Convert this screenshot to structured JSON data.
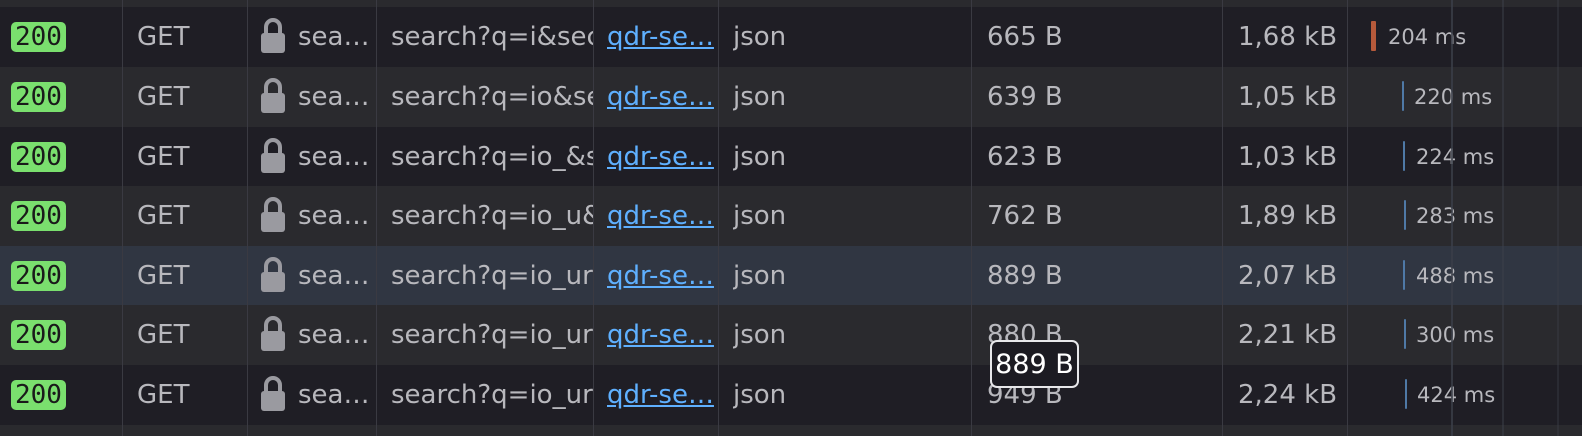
{
  "rows": [
    {
      "status": "200",
      "method": "GET",
      "domain": "sea…",
      "file": "search?q=i&sect",
      "initiator": "qdr-se…",
      "type": "json",
      "transferred": "665 B",
      "size": "1,68 kB",
      "duration": "204 ms",
      "bar_color": "#b65a3b"
    },
    {
      "status": "200",
      "method": "GET",
      "domain": "sea…",
      "file": "search?q=io&sec",
      "initiator": "qdr-se…",
      "type": "json",
      "transferred": "639 B",
      "size": "1,05 kB",
      "duration": "220 ms",
      "bar_color": "#4f79a6"
    },
    {
      "status": "200",
      "method": "GET",
      "domain": "sea…",
      "file": "search?q=io_&se",
      "initiator": "qdr-se…",
      "type": "json",
      "transferred": "623 B",
      "size": "1,03 kB",
      "duration": "224 ms",
      "bar_color": "#4f79a6"
    },
    {
      "status": "200",
      "method": "GET",
      "domain": "sea…",
      "file": "search?q=io_u&s",
      "initiator": "qdr-se…",
      "type": "json",
      "transferred": "762 B",
      "size": "1,89 kB",
      "duration": "283 ms",
      "bar_color": "#4f79a6"
    },
    {
      "status": "200",
      "method": "GET",
      "domain": "sea…",
      "file": "search?q=io_ur&",
      "initiator": "qdr-se…",
      "type": "json",
      "transferred": "889 B",
      "size": "2,07 kB",
      "duration": "488 ms",
      "bar_color": "#4f79a6"
    },
    {
      "status": "200",
      "method": "GET",
      "domain": "sea…",
      "file": "search?q=io_urin",
      "initiator": "qdr-se…",
      "type": "json",
      "transferred": "880 B",
      "size": "2,21 kB",
      "duration": "300 ms",
      "bar_color": "#4f79a6"
    },
    {
      "status": "200",
      "method": "GET",
      "domain": "sea…",
      "file": "search?q=io_urin",
      "initiator": "qdr-se…",
      "type": "json",
      "transferred": "949 B",
      "size": "2,24 kB",
      "duration": "424 ms",
      "bar_color": "#4f79a6"
    }
  ],
  "tooltip": {
    "text": "889 B"
  },
  "icons": {
    "domain_icon": "lock-icon"
  }
}
